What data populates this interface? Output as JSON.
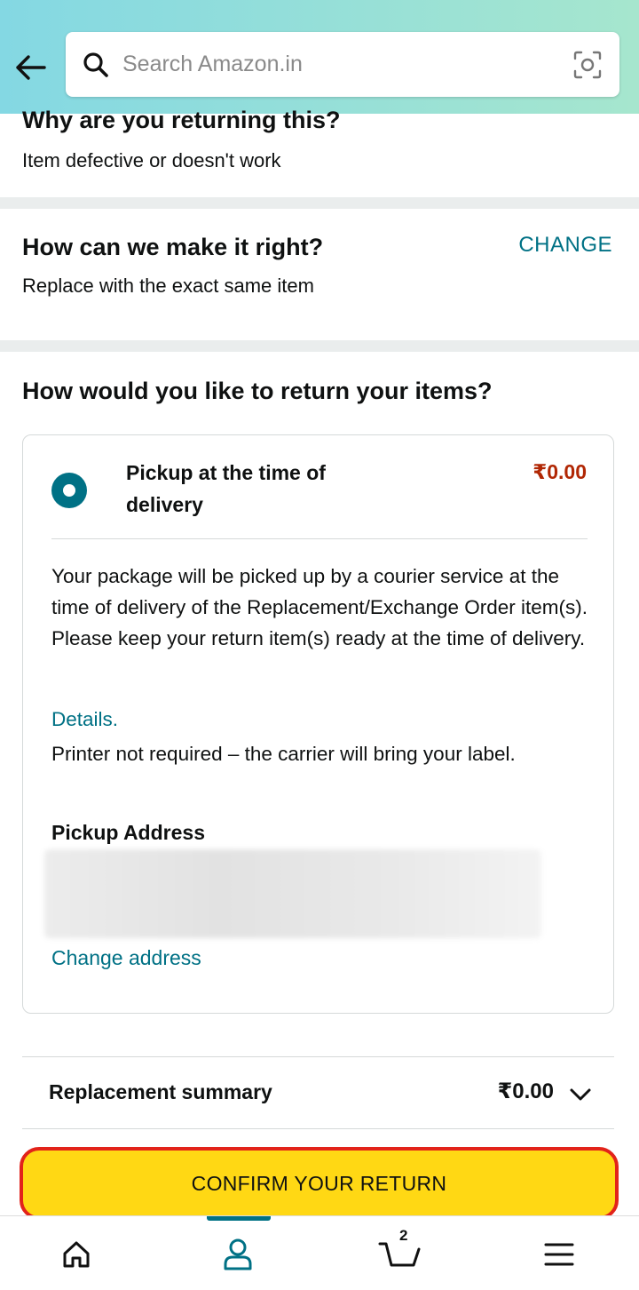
{
  "header": {
    "back_icon": "arrow-left-icon",
    "search_icon": "search-icon",
    "search_placeholder": "Search Amazon.in",
    "camera_icon": "camera-scan-icon",
    "gradient_colors": [
      "#84d8e3",
      "#a6e6ce"
    ]
  },
  "reason": {
    "title": "Why are you returning this?",
    "value": "Item defective or doesn't work"
  },
  "resolution": {
    "title": "How can we make it right?",
    "value": "Replace with the exact same item",
    "change_label": "CHANGE"
  },
  "return_method": {
    "title": "How would you like to return your items?",
    "option": {
      "label": "Pickup at the time of delivery",
      "price": "₹0.00",
      "selected": true,
      "description": "Your package will be picked up by a courier service at the time of delivery of the Replacement/Exchange Order item(s). Please keep your return item(s) ready at the time of delivery.",
      "details_link": "Details.",
      "printer_note": "Printer not required – the carrier will bring your label.",
      "address_title": "Pickup Address",
      "change_address": "Change address"
    }
  },
  "summary": {
    "label": "Replacement summary",
    "price": "₹0.00",
    "chevron_icon": "chevron-down-icon"
  },
  "confirm_button": "CONFIRM YOUR RETURN",
  "bottom_nav": {
    "items": [
      {
        "icon": "home-icon",
        "active": false
      },
      {
        "icon": "account-icon",
        "active": true
      },
      {
        "icon": "cart-icon",
        "count": "2",
        "active": false
      },
      {
        "icon": "menu-icon",
        "active": false
      }
    ]
  },
  "colors": {
    "accent": "#007185",
    "price": "#b12704",
    "button": "#ffd814",
    "button_border": "#e2231a"
  }
}
